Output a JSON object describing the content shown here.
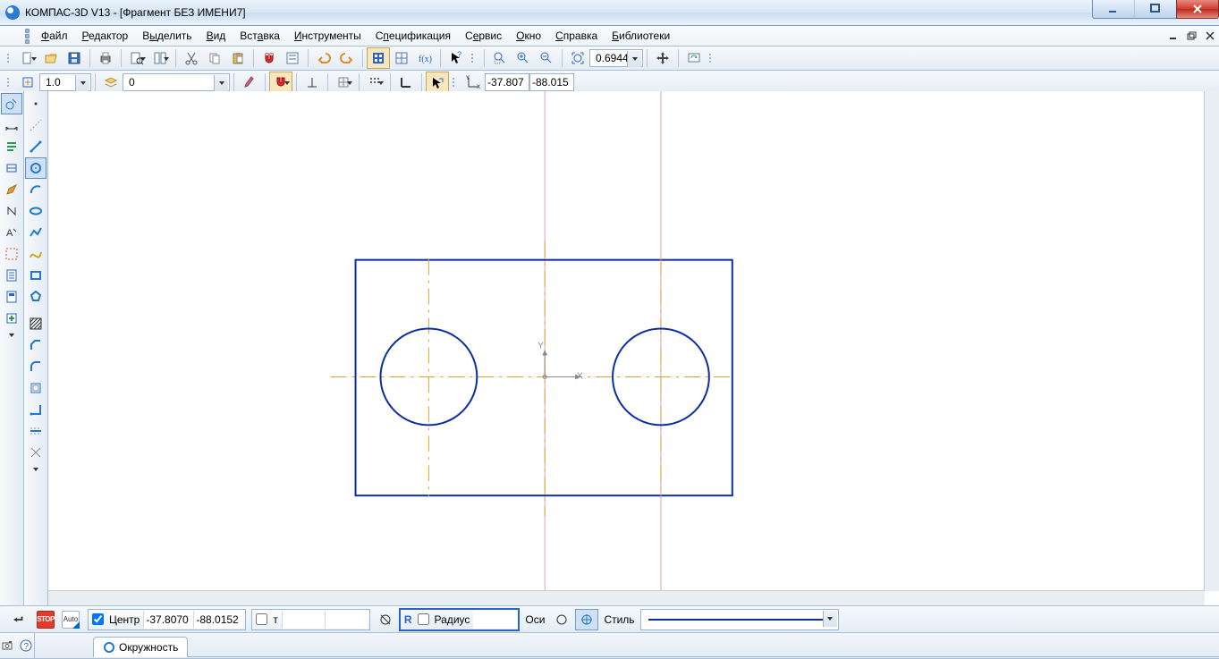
{
  "window": {
    "title": "КОМПАС-3D V13 - [Фрагмент БЕЗ ИМЕНИ7]"
  },
  "menu": {
    "file": "Файл",
    "editor": "Редактор",
    "select": "Выделить",
    "view": "Вид",
    "insert": "Вставка",
    "tools": "Инструменты",
    "spec": "Спецификация",
    "service": "Сервис",
    "window": "Окно",
    "help": "Справка",
    "libs": "Библиотеки"
  },
  "toolbar2": {
    "line_width": "1.0",
    "layer": "0",
    "coord_x": "-37.807",
    "coord_y": "-88.015"
  },
  "zoom": {
    "value": "0.6944"
  },
  "propbar": {
    "center_label": "Центр",
    "cx": "-37.8070",
    "cy": "-88.0152",
    "t_label": "т",
    "r_label": "R",
    "radius_label": "Радиус",
    "radius_value": "",
    "axes_label": "Оси",
    "style_label": "Стиль"
  },
  "status": {
    "tab": "Окружность"
  }
}
